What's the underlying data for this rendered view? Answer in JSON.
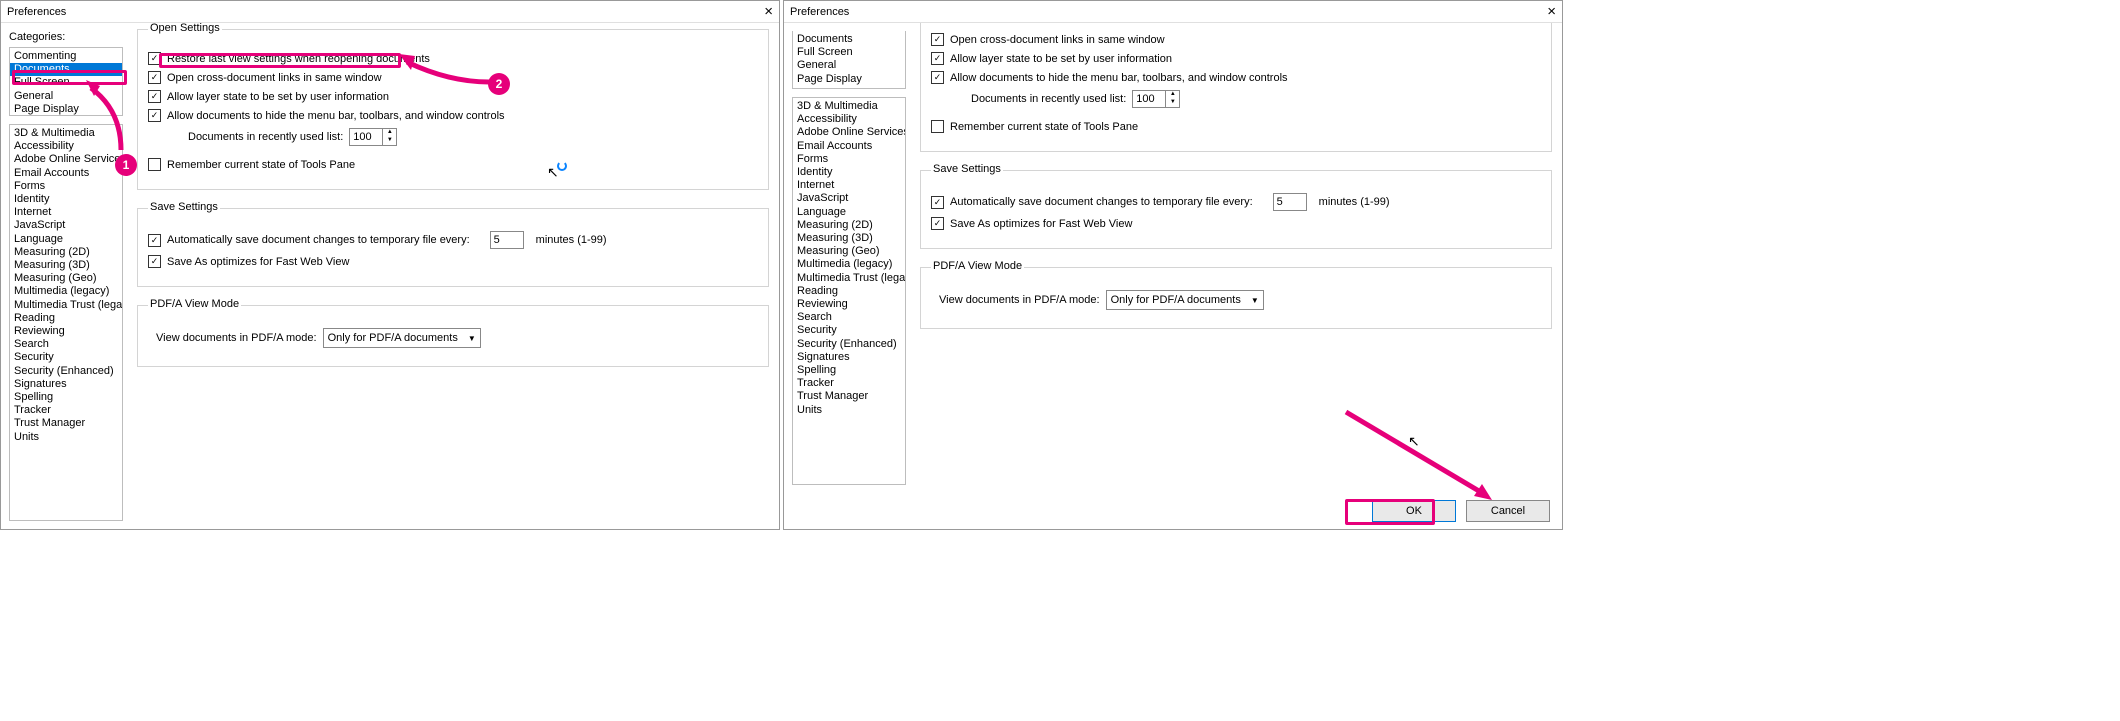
{
  "title": "Preferences",
  "categories_label": "Categories:",
  "cat_group1": [
    "Commenting",
    "Documents",
    "Full Screen",
    "General",
    "Page Display"
  ],
  "cat_group2": [
    "3D & Multimedia",
    "Accessibility",
    "Adobe Online Services",
    "Email Accounts",
    "Forms",
    "Identity",
    "Internet",
    "JavaScript",
    "Language",
    "Measuring (2D)",
    "Measuring (3D)",
    "Measuring (Geo)",
    "Multimedia (legacy)",
    "Multimedia Trust (legacy)",
    "Reading",
    "Reviewing",
    "Search",
    "Security",
    "Security (Enhanced)",
    "Signatures",
    "Spelling",
    "Tracker",
    "Trust Manager",
    "Units"
  ],
  "selected_cat": "Documents",
  "open_settings": {
    "legend": "Open Settings",
    "restore": "Restore last view settings when reopening documents",
    "cross": "Open cross-document links in same window",
    "layer": "Allow layer state to be set by user information",
    "hide": "Allow documents to hide the menu bar, toolbars, and window controls",
    "recent_label": "Documents in recently used list:",
    "recent_val": "100",
    "remember": "Remember current state of Tools Pane"
  },
  "save_settings": {
    "legend": "Save Settings",
    "auto": "Automatically save document changes to temporary file every:",
    "auto_val": "5",
    "auto_unit": "minutes (1-99)",
    "fast": "Save As optimizes for Fast Web View"
  },
  "pdfa": {
    "legend": "PDF/A View Mode",
    "label": "View documents in PDF/A mode:",
    "value": "Only for PDF/A documents"
  },
  "buttons": {
    "ok": "OK",
    "cancel": "Cancel"
  },
  "ann": {
    "one": "1",
    "two": "2"
  }
}
